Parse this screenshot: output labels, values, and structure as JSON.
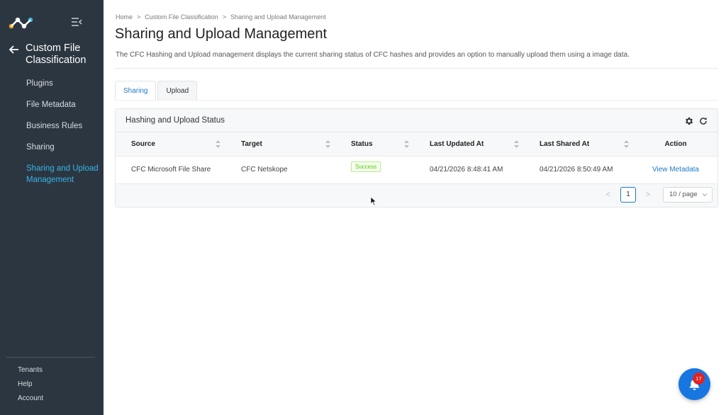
{
  "sidebar": {
    "section_title": "Custom File Classification",
    "items": [
      {
        "label": "Plugins"
      },
      {
        "label": "File Metadata"
      },
      {
        "label": "Business Rules"
      },
      {
        "label": "Sharing"
      },
      {
        "label": "Sharing and Upload Management",
        "active": true
      }
    ],
    "bottom_items": [
      {
        "label": "Tenants"
      },
      {
        "label": "Help"
      },
      {
        "label": "Account"
      }
    ]
  },
  "breadcrumb": [
    "Home",
    "Custom File Classification",
    "Sharing and Upload Management"
  ],
  "breadcrumb_separator": ">",
  "page": {
    "title": "Sharing and Upload Management",
    "description": "The CFC Hashing and Upload management displays the current sharing status of CFC hashes and provides an option to manually upload them using a image data."
  },
  "tabs": [
    {
      "label": "Sharing",
      "active": true
    },
    {
      "label": "Upload",
      "active": false
    }
  ],
  "card": {
    "title": "Hashing and Upload Status"
  },
  "table": {
    "columns": [
      "Source",
      "Target",
      "Status",
      "Last Updated At",
      "Last Shared At",
      "Action"
    ],
    "rows": [
      {
        "source": "CFC Microsoft File Share",
        "target": "CFC Netskope",
        "status": "Success",
        "last_updated": "04/21/2026 8:48:41 AM",
        "last_shared": "04/21/2026 8:50:49 AM",
        "action": "View Metadata"
      }
    ]
  },
  "pagination": {
    "prev": "<",
    "current_page": "1",
    "next": ">",
    "page_size": "10 / page"
  },
  "notifications": {
    "count": "17"
  },
  "colors": {
    "sidebar_bg": "#2c3640",
    "active_nav": "#35b5e7",
    "link": "#1f79c9",
    "success": "#52c41a",
    "fab": "#1876e0",
    "badge": "#e02424"
  }
}
